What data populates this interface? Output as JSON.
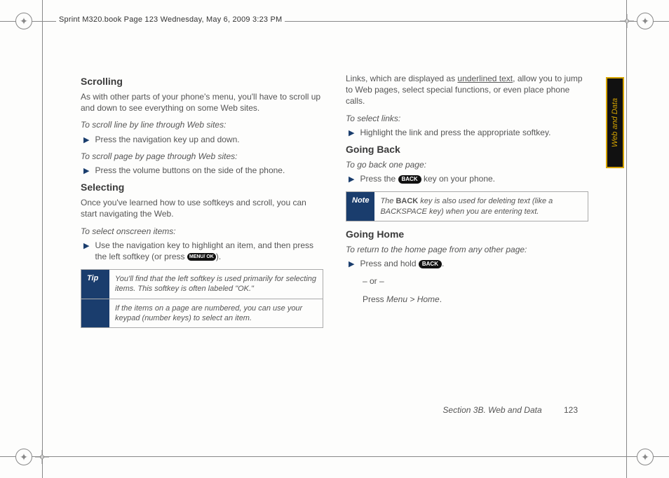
{
  "doc_header": "Sprint M320.book  Page 123  Wednesday, May 6, 2009  3:23 PM",
  "side_tab": "Web and Data",
  "footer_section": "Section 3B. Web and Data",
  "footer_page": "123",
  "left": {
    "h_scrolling": "Scrolling",
    "p_scroll_intro": "As with other parts of your phone's menu, you'll have to scroll up and down to see everything on some Web sites.",
    "sub_scroll_line": "To scroll line by line through Web sites:",
    "b_scroll_line": "Press the navigation key up and down.",
    "sub_scroll_page": "To scroll page by page through Web sites:",
    "b_scroll_page": "Press the volume buttons on the side of the phone.",
    "h_selecting": "Selecting",
    "p_select_intro": "Once you've learned how to use softkeys and scroll, you can start navigating the Web.",
    "sub_select": "To select onscreen items:",
    "b_select_a": "Use the navigation key to highlight an item, and then press the left softkey (or press ",
    "b_select_c": ").",
    "key_menu_ok": "MENU/\nOK",
    "tip_label": "Tip",
    "tip_body1": "You'll find that the left softkey is used primarily for selecting items. This softkey is often labeled \"OK.\"",
    "tip_body2": "If the items on a page are numbered, you can use your keypad (number keys) to select an item."
  },
  "right": {
    "p_links_a": "Links, which are displayed as ",
    "p_links_u": "underlined text",
    "p_links_b": ", allow you to jump to Web pages, select special functions, or even place phone calls.",
    "sub_links": "To select links:",
    "b_links": "Highlight the link and press the appropriate softkey.",
    "h_back": "Going Back",
    "sub_back": "To go back one page:",
    "b_back_a": "Press the ",
    "key_back": "BACK",
    "b_back_b": " key on your phone.",
    "note_label": "Note",
    "note_body_a": "The ",
    "note_body_bold": "BACK",
    "note_body_b": " key is also used for deleting text (like a BACKSPACE key) when you are entering text.",
    "h_home": "Going Home",
    "sub_home": "To return to the home page from any other page:",
    "b_home_a": "Press and hold ",
    "b_home_c": ".",
    "or_text": "– or –",
    "press_prefix": "Press ",
    "menu_path": "Menu > Home",
    "path_suffix": "."
  }
}
